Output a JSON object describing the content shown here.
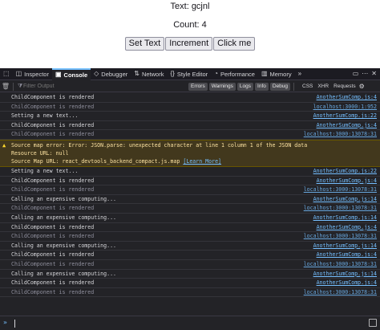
{
  "app": {
    "text_line": "Text: gcjnl",
    "count_line": "Count: 4",
    "buttons": [
      "Set Text",
      "Increment",
      "Click me"
    ]
  },
  "devtools": {
    "tabs": [
      {
        "label": "Inspector",
        "icon": "inspector-icon"
      },
      {
        "label": "Console",
        "icon": "console-icon",
        "selected": true
      },
      {
        "label": "Debugger",
        "icon": "debugger-icon"
      },
      {
        "label": "Network",
        "icon": "network-icon"
      },
      {
        "label": "Style Editor",
        "icon": "style-editor-icon"
      },
      {
        "label": "Performance",
        "icon": "performance-icon"
      },
      {
        "label": "Memory",
        "icon": "memory-icon"
      }
    ],
    "filter_placeholder": "Filter Output",
    "levels": [
      "Errors",
      "Warnings",
      "Logs",
      "Info",
      "Debug"
    ],
    "net_filters": [
      "CSS",
      "XHR",
      "Requests"
    ],
    "messages": [
      {
        "text": "ChildComponent is rendered",
        "source": "AnotherSumComp.js:4",
        "dim": false
      },
      {
        "text": "ChildComponent is rendered",
        "source": "localhost:3000:1:952",
        "dim": true
      },
      {
        "text": "Setting a new text...",
        "source": "AnotherSumComp.js:22",
        "dim": false
      },
      {
        "text": "ChildComponent is rendered",
        "source": "AnotherSumComp.js:4",
        "dim": false
      },
      {
        "text": "ChildComponent is rendered",
        "source": "localhost:3000:13078:31",
        "dim": true
      }
    ],
    "warning": {
      "line1": "Source map error: Error: JSON.parse: unexpected character at line 1 column 1 of the JSON data",
      "line2": "Resource URL: null",
      "line3": "Source Map URL: react_devtools_backend_compact.js.map",
      "learn_more": "[Learn More]"
    },
    "messages_after": [
      {
        "text": "Setting a new text...",
        "source": "AnotherSumComp.js:22",
        "dim": false
      },
      {
        "text": "ChildComponent is rendered",
        "source": "AnotherSumComp.js:4",
        "dim": false
      },
      {
        "text": "ChildComponent is rendered",
        "source": "localhost:3000:13078:31",
        "dim": true
      },
      {
        "text": "Calling an expensive computing...",
        "source": "AnotherSumComp.js:14",
        "dim": false
      },
      {
        "text": "ChildComponent is rendered",
        "source": "localhost:3000:13078:31",
        "dim": true
      },
      {
        "text": "Calling an expensive computing...",
        "source": "AnotherSumComp.js:14",
        "dim": false
      },
      {
        "text": "ChildComponent is rendered",
        "source": "AnotherSumComp.js:4",
        "dim": false
      },
      {
        "text": "ChildComponent is rendered",
        "source": "localhost:3000:13078:31",
        "dim": true
      },
      {
        "text": "Calling an expensive computing...",
        "source": "AnotherSumComp.js:14",
        "dim": false
      },
      {
        "text": "ChildComponent is rendered",
        "source": "AnotherSumComp.js:4",
        "dim": false
      },
      {
        "text": "ChildComponent is rendered",
        "source": "localhost:3000:13078:31",
        "dim": true
      },
      {
        "text": "Calling an expensive computing...",
        "source": "AnotherSumComp.js:14",
        "dim": false
      },
      {
        "text": "ChildComponent is rendered",
        "source": "AnotherSumComp.js:4",
        "dim": false
      },
      {
        "text": "ChildComponent is rendered",
        "source": "localhost:3000:13078:31",
        "dim": true
      }
    ]
  }
}
